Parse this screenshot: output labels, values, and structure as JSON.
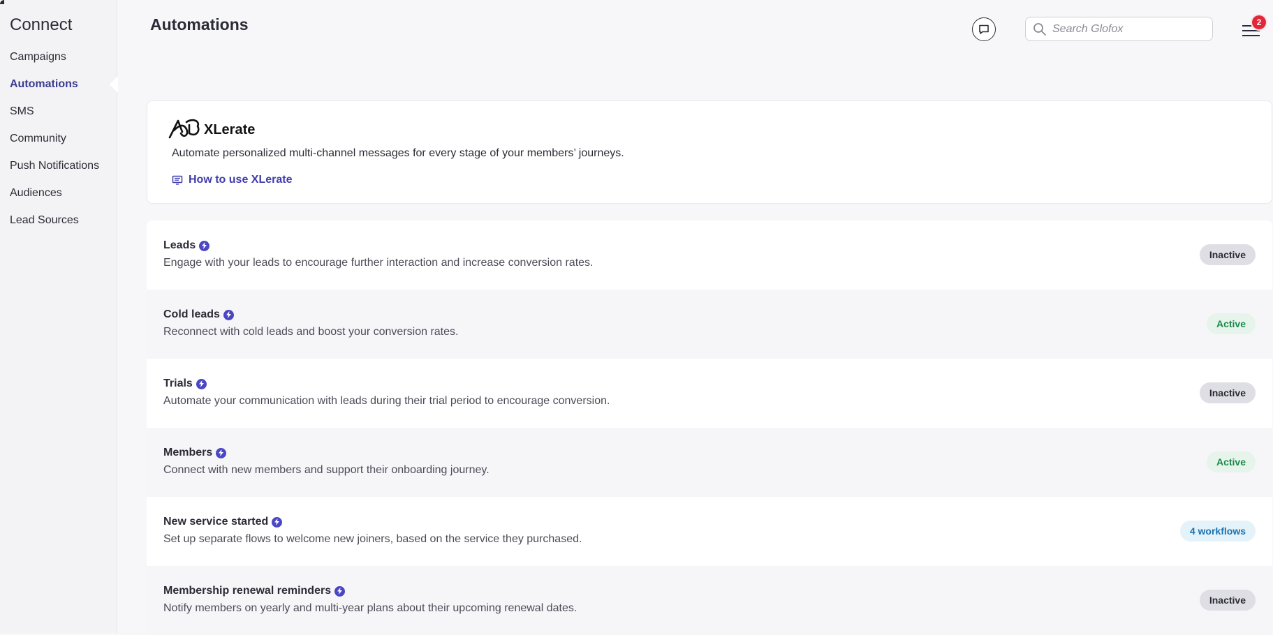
{
  "sidebar": {
    "title": "Connect",
    "items": [
      {
        "label": "Campaigns"
      },
      {
        "label": "Automations"
      },
      {
        "label": "SMS"
      },
      {
        "label": "Community"
      },
      {
        "label": "Push Notifications"
      },
      {
        "label": "Audiences"
      },
      {
        "label": "Lead Sources"
      }
    ],
    "active_item": "Automations"
  },
  "header": {
    "title": "Automations",
    "search_placeholder": "Search Glofox",
    "notification_count": "2",
    "icons": [
      "chat-icon",
      "search-icon",
      "menu-icon"
    ]
  },
  "intro": {
    "brand": "XLerate",
    "description": "Automate personalized multi-channel messages for every stage of your members’ journeys.",
    "link_label": "How to use XLerate"
  },
  "automations": [
    {
      "title": "Leads",
      "description": "Engage with your leads to encourage further interaction and increase conversion rates.",
      "status": "Inactive",
      "status_type": "inactive"
    },
    {
      "title": "Cold leads",
      "description": "Reconnect with cold leads and boost your conversion rates.",
      "status": "Active",
      "status_type": "active"
    },
    {
      "title": "Trials",
      "description": "Automate your communication with leads during their trial period to encourage conversion.",
      "status": "Inactive",
      "status_type": "inactive"
    },
    {
      "title": "Members",
      "description": "Connect with new members and support their onboarding journey.",
      "status": "Active",
      "status_type": "active"
    },
    {
      "title": "New service started",
      "description": "Set up separate flows to welcome new joiners, based on the service they purchased.",
      "status": "4 workflows",
      "status_type": "info"
    },
    {
      "title": "Membership renewal reminders",
      "description": "Notify members on yearly and multi-year plans about their upcoming renewal dates.",
      "status": "Inactive",
      "status_type": "inactive"
    }
  ],
  "colors": {
    "accent": "#3f3cab",
    "bolt": "#4b47c4",
    "active_text": "#1c8a4a",
    "info_text": "#1b72b0",
    "badge": "#e0283a"
  }
}
